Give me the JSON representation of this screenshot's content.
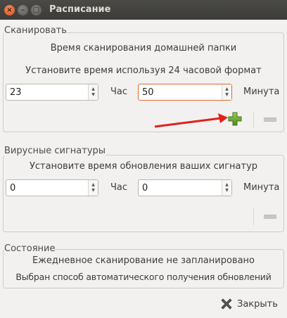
{
  "window": {
    "title": "Расписание"
  },
  "scan": {
    "label": "Сканировать",
    "heading": "Время сканирования домашней папки",
    "format_hint": "Установите время используя 24 часовой формат",
    "hour_value": "23",
    "hour_unit": "Час",
    "minute_value": "50",
    "minute_unit": "Минута"
  },
  "signatures": {
    "label": "Вирусные сигнатуры",
    "heading": "Установите время обновления ваших сигнатур",
    "hour_value": "0",
    "hour_unit": "Час",
    "minute_value": "0",
    "minute_unit": "Минута"
  },
  "status": {
    "label": "Состояние",
    "line1": "Ежедневное сканирование не запланировано",
    "line2": "Выбран способ автоматического получения обновлений"
  },
  "footer": {
    "close_label": "Закрыть"
  },
  "colors": {
    "accent": "#e0692f",
    "add_green": "#6ea22c",
    "arrow_red": "#e0201b"
  }
}
